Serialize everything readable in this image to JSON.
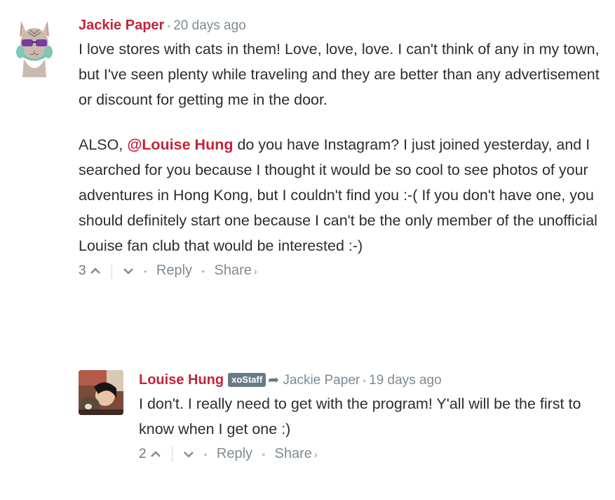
{
  "comments": [
    {
      "author": "Jackie Paper",
      "time": "20 days ago",
      "paragraph1": "I love stores with cats in them! Love, love, love. I can't think of any in my town, but I've seen plenty while traveling and they are better than any advertisement or discount for getting me in the door.",
      "paragraph2_pre": "ALSO, ",
      "mention": "@Louise Hung",
      "paragraph2_post": " do you have Instagram? I just joined yesterday, and I searched for you because I thought it would be so cool to see photos of your adventures in Hong Kong, but I couldn't find you :-( If you don't have one, you should definitely start one because I can't be the only member of the unofficial Louise fan club that would be interested :-)",
      "votes": "3",
      "reply_label": "Reply",
      "share_label": "Share",
      "avatar_icon": "cat-with-sunglasses-avatar"
    },
    {
      "author": "Louise Hung",
      "badge": "xoStaff",
      "reply_to": "Jackie Paper",
      "time": "19 days ago",
      "text": "I don't. I really need to get with the program! Y'all will be the first to know when I get one :)",
      "votes": "2",
      "reply_label": "Reply",
      "share_label": "Share",
      "avatar_icon": "user-photo-avatar"
    }
  ],
  "colors": {
    "author": "#c2243b",
    "meta": "#7f8a94",
    "badge_bg": "#687a86",
    "text": "#2a2e2e"
  }
}
